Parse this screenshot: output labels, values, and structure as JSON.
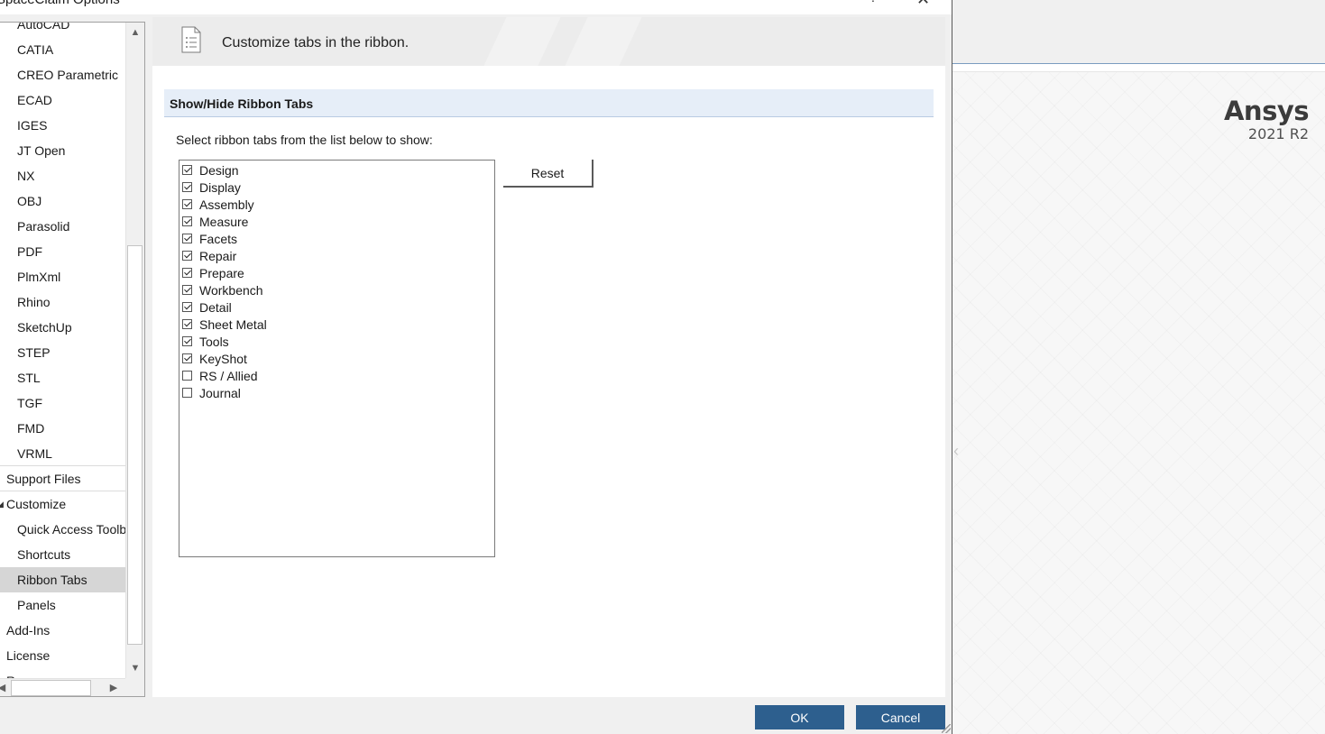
{
  "dialog": {
    "title": "SpaceClaim Options",
    "help_glyph": "?",
    "close_glyph": "✕"
  },
  "nav": {
    "items": [
      {
        "label": "AutoCAD",
        "level": 2
      },
      {
        "label": "CATIA",
        "level": 2
      },
      {
        "label": "CREO Parametric",
        "level": 2
      },
      {
        "label": "ECAD",
        "level": 2
      },
      {
        "label": "IGES",
        "level": 2
      },
      {
        "label": "JT Open",
        "level": 2
      },
      {
        "label": "NX",
        "level": 2
      },
      {
        "label": "OBJ",
        "level": 2
      },
      {
        "label": "Parasolid",
        "level": 2
      },
      {
        "label": "PDF",
        "level": 2
      },
      {
        "label": "PlmXml",
        "level": 2
      },
      {
        "label": "Rhino",
        "level": 2
      },
      {
        "label": "SketchUp",
        "level": 2
      },
      {
        "label": "STEP",
        "level": 2
      },
      {
        "label": "STL",
        "level": 2
      },
      {
        "label": "TGF",
        "level": 2
      },
      {
        "label": "FMD",
        "level": 2
      },
      {
        "label": "VRML",
        "level": 2
      },
      {
        "label": "Support Files",
        "level": 1
      },
      {
        "label": "Customize",
        "level": 1,
        "expanded": true
      },
      {
        "label": "Quick Access Toolbar",
        "level": 2
      },
      {
        "label": "Shortcuts",
        "level": 2
      },
      {
        "label": "Ribbon Tabs",
        "level": 2,
        "selected": true
      },
      {
        "label": "Panels",
        "level": 2
      },
      {
        "label": "Add-Ins",
        "level": 1
      },
      {
        "label": "License",
        "level": 1
      },
      {
        "label": "Resources",
        "level": 1
      }
    ]
  },
  "panel": {
    "banner_text": "Customize tabs in the ribbon.",
    "banner_icon": "document-list-icon",
    "section_title": "Show/Hide Ribbon Tabs",
    "instruction": "Select ribbon tabs from the list below to show:",
    "reset_label": "Reset",
    "tabs": [
      {
        "label": "Design",
        "checked": true
      },
      {
        "label": "Display",
        "checked": true
      },
      {
        "label": "Assembly",
        "checked": true
      },
      {
        "label": "Measure",
        "checked": true
      },
      {
        "label": "Facets",
        "checked": true
      },
      {
        "label": "Repair",
        "checked": true
      },
      {
        "label": "Prepare",
        "checked": true
      },
      {
        "label": "Workbench",
        "checked": true
      },
      {
        "label": "Detail",
        "checked": true
      },
      {
        "label": "Sheet Metal",
        "checked": true
      },
      {
        "label": "Tools",
        "checked": true
      },
      {
        "label": "KeyShot",
        "checked": true
      },
      {
        "label": "RS / Allied",
        "checked": false
      },
      {
        "label": "Journal",
        "checked": false
      }
    ]
  },
  "footer": {
    "ok_label": "OK",
    "cancel_label": "Cancel"
  },
  "background_app": {
    "brand_name": "Ansys",
    "brand_version": "2021 R2"
  },
  "colors": {
    "primary_button": "#2d5f8e",
    "section_header": "#e6eef8",
    "selected_nav": "#d6d6d6"
  }
}
